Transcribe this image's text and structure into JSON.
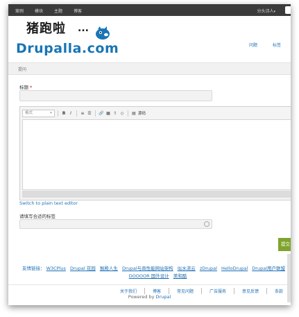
{
  "topbar": {
    "nav": [
      "案例",
      "模块",
      "主题",
      "博客"
    ],
    "user": "分头诗人",
    "user_caret": "▾"
  },
  "logo": {
    "cn": "猪跑啦",
    "dots": "...",
    "en": "Drupalla.com"
  },
  "header_nav": [
    "问题",
    "标签"
  ],
  "breadcrumb": "提问",
  "form": {
    "title_label": "标题",
    "required_mark": "*",
    "title_value": "",
    "editor": {
      "style_placeholder": "格式",
      "buttons": [
        "B",
        "I",
        "≡",
        "☰",
        "🔗",
        "▦",
        "⇧",
        "◇"
      ],
      "source_label": "源码"
    },
    "plain_text_link": "Switch to plain text editor",
    "tags_label": "请填写合适的标签",
    "tags_value": "",
    "submit_label": "提交"
  },
  "friend_links": {
    "label": "友情链接：",
    "row1": [
      "W3CPlus",
      "Drupal 花园",
      "猴殿人生",
      "Drupal与商性能网站架构",
      "似水流云",
      "zDrupal",
      "HelloDrupal",
      "Drupal用户联盟"
    ],
    "row2": [
      "DOOOOR 国外设计",
      "美和酷"
    ]
  },
  "footer": {
    "links": [
      "关于我们",
      "博客",
      "常见问题",
      "广告服务",
      "意见反馈",
      "条款"
    ],
    "powered_prefix": "Powered by ",
    "powered_brand": "Drupal"
  },
  "colors": {
    "topbar": "#3b3b3b",
    "link": "#1f6fb5",
    "logo_blue": "#1975b5",
    "submit": "#7fa42c"
  }
}
